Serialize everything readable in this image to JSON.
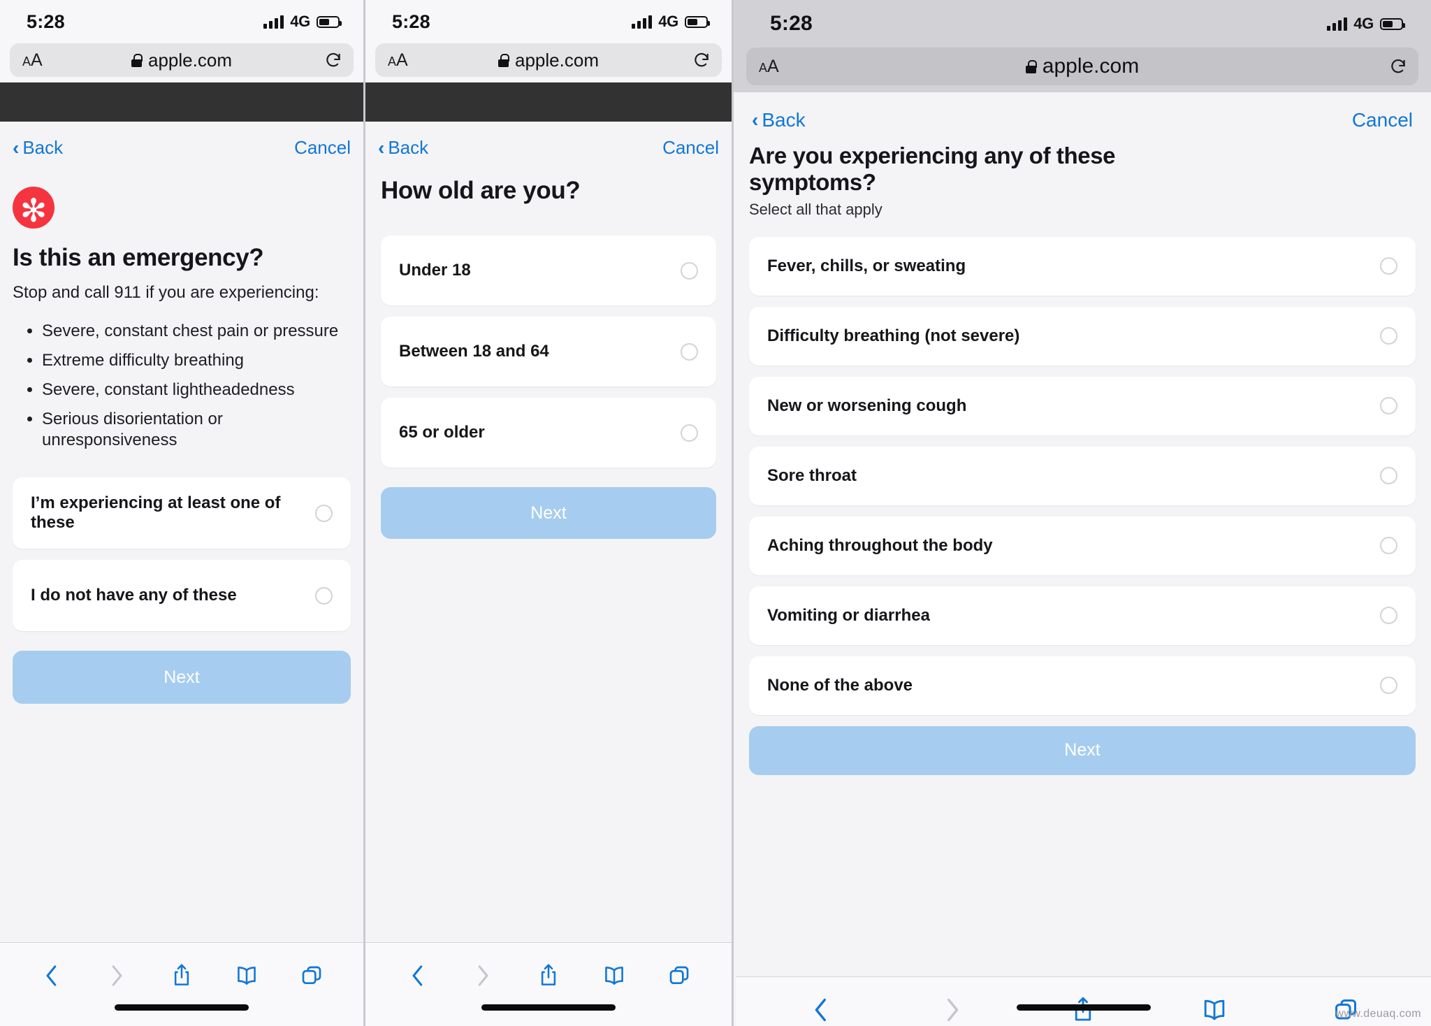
{
  "browser": {
    "status": {
      "time": "5:28",
      "network": "4G",
      "signal_bars": 4,
      "battery_level": 55
    },
    "url_bar": {
      "text_size_label_small": "A",
      "text_size_label_big": "A",
      "domain": "apple.com",
      "lock_icon": "lock-icon",
      "reload_icon": "reload-icon"
    },
    "site_header": {
      "logo": "apple-logo"
    },
    "toolbar": {
      "back_icon": "chevron-left-icon",
      "forward_icon": "chevron-right-icon",
      "share_icon": "share-icon",
      "bookmarks_icon": "book-icon",
      "tabs_icon": "tabs-icon"
    }
  },
  "nav": {
    "back_label": "Back",
    "cancel_label": "Cancel"
  },
  "screens": [
    {
      "id": "emergency",
      "badge_icon": "asterisk-icon",
      "badge_color": "#f5343f",
      "badge_glyph": "✻",
      "title": "Is this an emergency?",
      "lede": "Stop and call 911 if you are experiencing:",
      "bullets": [
        "Severe, constant chest pain or pressure",
        "Extreme difficulty breathing",
        "Severe, constant lightheadedness",
        "Serious disorientation or unresponsiveness"
      ],
      "options": [
        {
          "label": "I’m experiencing at least one of these",
          "selected": false
        },
        {
          "label": "I do not have any of these",
          "selected": false
        }
      ],
      "next_label": "Next"
    },
    {
      "id": "age",
      "title": "How old are you?",
      "options": [
        {
          "label": "Under 18",
          "selected": false
        },
        {
          "label": "Between 18 and 64",
          "selected": false
        },
        {
          "label": "65 or older",
          "selected": false
        }
      ],
      "next_label": "Next"
    },
    {
      "id": "symptoms",
      "title": "Are you experiencing any of these symptoms?",
      "subtitle": "Select all that apply",
      "options": [
        {
          "label": "Fever, chills, or sweating",
          "selected": false
        },
        {
          "label": "Difficulty breathing (not severe)",
          "selected": false
        },
        {
          "label": "New or worsening cough",
          "selected": false
        },
        {
          "label": "Sore throat",
          "selected": false
        },
        {
          "label": "Aching throughout the body",
          "selected": false
        },
        {
          "label": "Vomiting or diarrhea",
          "selected": false
        },
        {
          "label": "None of the above",
          "selected": false
        }
      ],
      "next_label": "Next"
    }
  ],
  "colors": {
    "accent_blue": "#1277d4",
    "button_disabled": "#a6cdef",
    "emergency_red": "#f5343f",
    "page_bg": "#f4f4f7"
  },
  "watermark": "www.deuaq.com"
}
